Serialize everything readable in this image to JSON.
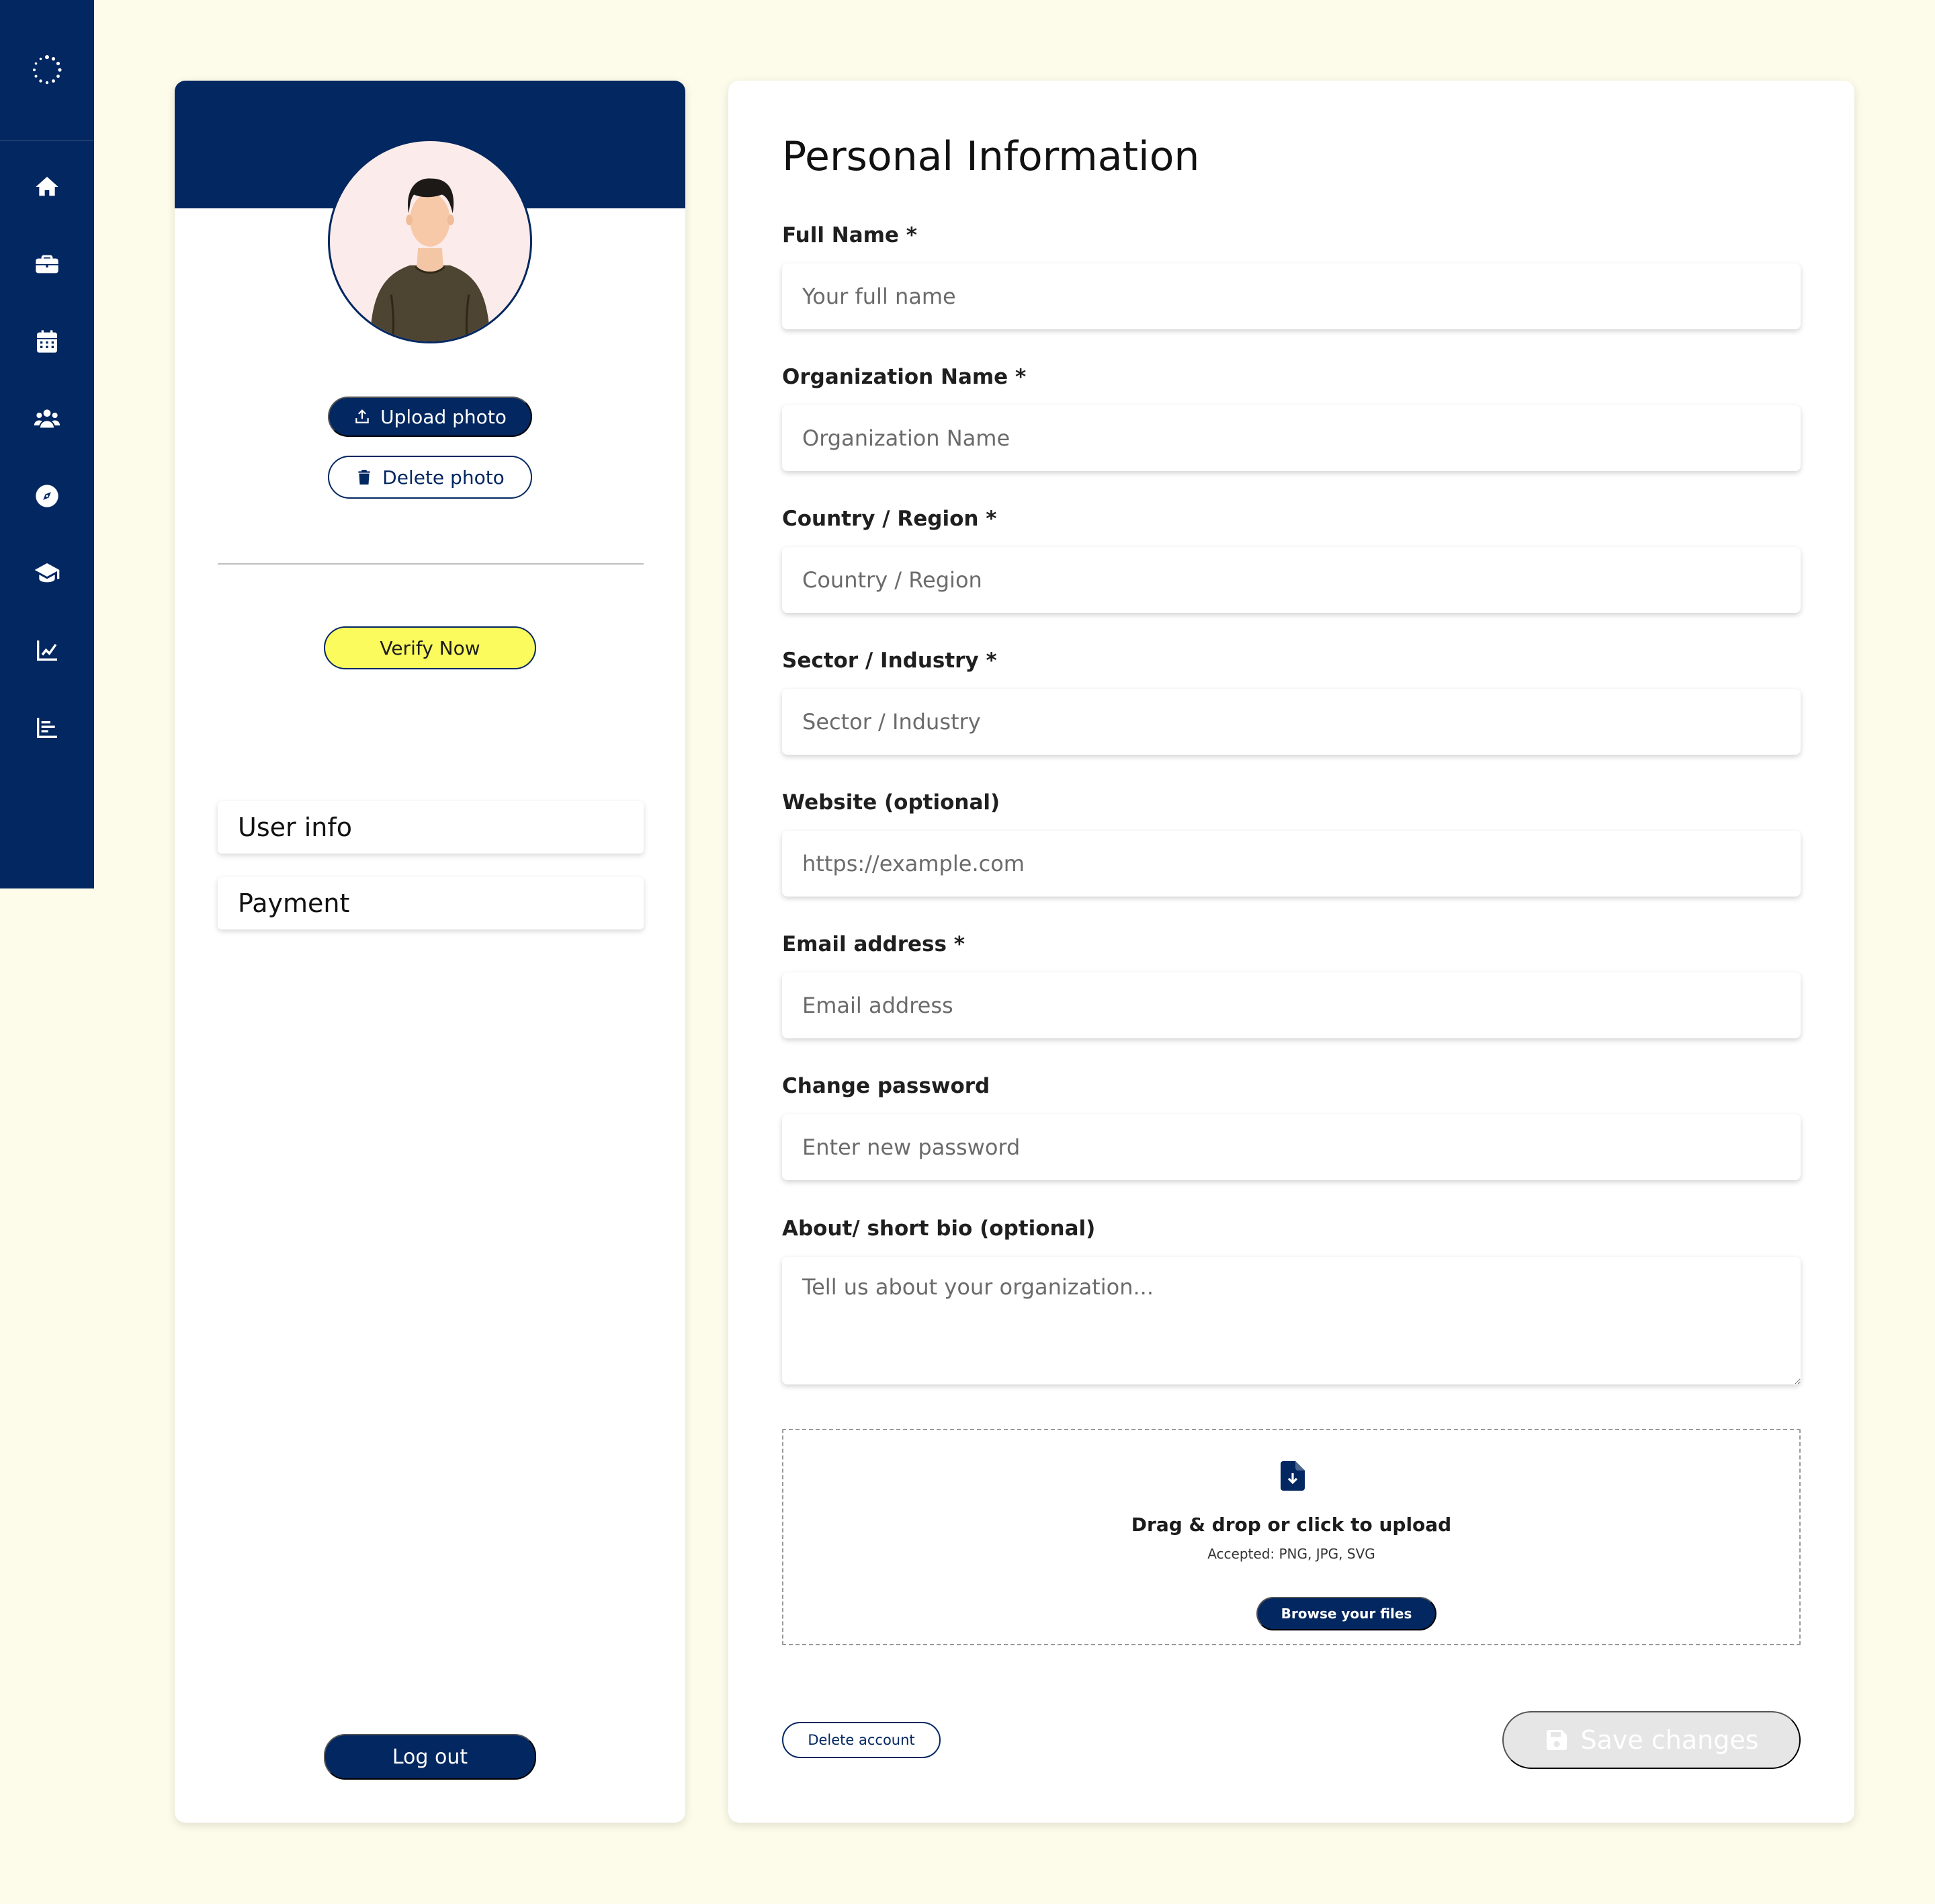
{
  "colors": {
    "background": "#fdfcea",
    "brand_navy": "#032760",
    "verify_yellow": "#fbfb5e",
    "disabled_gray": "#e6e6e6"
  },
  "sidebar": {
    "logo_icon": "spinner-logo-icon",
    "items": [
      {
        "icon": "home-icon"
      },
      {
        "icon": "briefcase-icon"
      },
      {
        "icon": "calendar-icon"
      },
      {
        "icon": "users-icon"
      },
      {
        "icon": "compass-icon"
      },
      {
        "icon": "graduation-cap-icon"
      },
      {
        "icon": "line-chart-icon"
      },
      {
        "icon": "bar-chart-icon"
      }
    ]
  },
  "profile": {
    "avatar": "avatar-illustration",
    "upload_photo_label": "Upload photo",
    "delete_photo_label": "Delete photo",
    "verify_label": "Verify Now",
    "menu": {
      "user_info": "User info",
      "payment": "Payment"
    },
    "logout_label": "Log out"
  },
  "form": {
    "title": "Personal Information",
    "fields": {
      "full_name": {
        "label": "Full Name *",
        "placeholder": "Your full name",
        "value": ""
      },
      "organization": {
        "label": "Organization Name *",
        "placeholder": "Organization Name",
        "value": ""
      },
      "country": {
        "label": "Country / Region *",
        "placeholder": "Country / Region",
        "value": ""
      },
      "sector": {
        "label": "Sector / Industry *",
        "placeholder": "Sector / Industry",
        "value": ""
      },
      "website": {
        "label": "Website (optional)",
        "placeholder": "https://example.com",
        "value": ""
      },
      "email": {
        "label": "Email address *",
        "placeholder": "Email address",
        "value": ""
      },
      "password": {
        "label": "Change password",
        "placeholder": "Enter new password",
        "value": ""
      },
      "bio": {
        "label": "About/ short bio (optional)",
        "placeholder": "Tell us about your organization...",
        "value": ""
      }
    },
    "upload": {
      "icon": "file-download-icon",
      "title": "Drag & drop or click to upload",
      "accepted": "Accepted: PNG, JPG, SVG",
      "browse_label": "Browse your files"
    },
    "delete_account_label": "Delete account",
    "save_label": "Save changes"
  }
}
